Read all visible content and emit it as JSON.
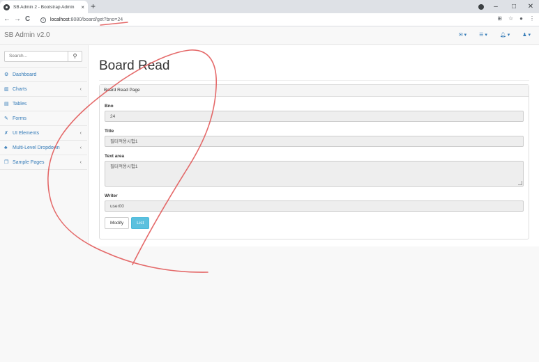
{
  "browser": {
    "tab_title": "SB Admin 2 - Bootstrap Admin",
    "tab_close": "×",
    "new_tab": "+",
    "url_host": "localhost",
    "url_rest": ":8080/board/get?bno=24",
    "window_controls": {
      "minimize": "–",
      "maximize": "□",
      "close": "✕"
    },
    "nav": {
      "back": "←",
      "forward": "→",
      "reload": "C"
    }
  },
  "app": {
    "brand": "SB Admin v2.0",
    "header_icons": [
      "envelope-icon",
      "tasks-icon",
      "bell-icon",
      "user-icon"
    ]
  },
  "sidebar": {
    "search_placeholder": "Search...",
    "items": [
      {
        "label": "Dashboard",
        "icon": "dashboard-icon",
        "glyph": "⚙",
        "arrow": ""
      },
      {
        "label": "Charts",
        "icon": "bar-chart-icon",
        "glyph": "▥",
        "arrow": "‹"
      },
      {
        "label": "Tables",
        "icon": "table-icon",
        "glyph": "▤",
        "arrow": ""
      },
      {
        "label": "Forms",
        "icon": "edit-icon",
        "glyph": "✎",
        "arrow": ""
      },
      {
        "label": "UI Elements",
        "icon": "wrench-icon",
        "glyph": "✗",
        "arrow": "‹"
      },
      {
        "label": "Multi-Level Dropdown",
        "icon": "sitemap-icon",
        "glyph": "♣",
        "arrow": "‹"
      },
      {
        "label": "Sample Pages",
        "icon": "files-icon",
        "glyph": "❐",
        "arrow": "‹"
      }
    ]
  },
  "main": {
    "title": "Board Read",
    "panel_heading": "Board Read Page",
    "fields": {
      "bno_label": "Bno",
      "bno_value": "24",
      "title_label": "Title",
      "title_value": "필터적용시험1",
      "content_label": "Text area",
      "content_value": "필터적용시험1",
      "writer_label": "Writer",
      "writer_value": "user00"
    },
    "buttons": {
      "modify": "Modify",
      "list": "List"
    }
  },
  "colors": {
    "link": "#337ab7",
    "info_button": "#5bc0de",
    "annotation": "#e05050"
  }
}
